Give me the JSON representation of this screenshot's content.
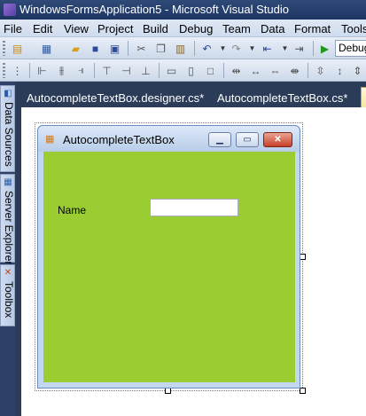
{
  "window": {
    "title": "WindowsFormsApplication5 - Microsoft Visual Studio"
  },
  "menu": [
    "File",
    "Edit",
    "View",
    "Project",
    "Build",
    "Debug",
    "Team",
    "Data",
    "Format",
    "Tools"
  ],
  "toolbar": {
    "configuration": "Debug"
  },
  "side_tabs": [
    "Data Sources",
    "Server Explorer",
    "Toolbox"
  ],
  "doc_tabs": [
    "AutocompleteTextBox.designer.cs*",
    "AutocompleteTextBox.cs*"
  ],
  "form": {
    "title": "AutocompleteTextBox",
    "name_label": "Name",
    "name_value": "",
    "back_color": "#9ACD32"
  }
}
